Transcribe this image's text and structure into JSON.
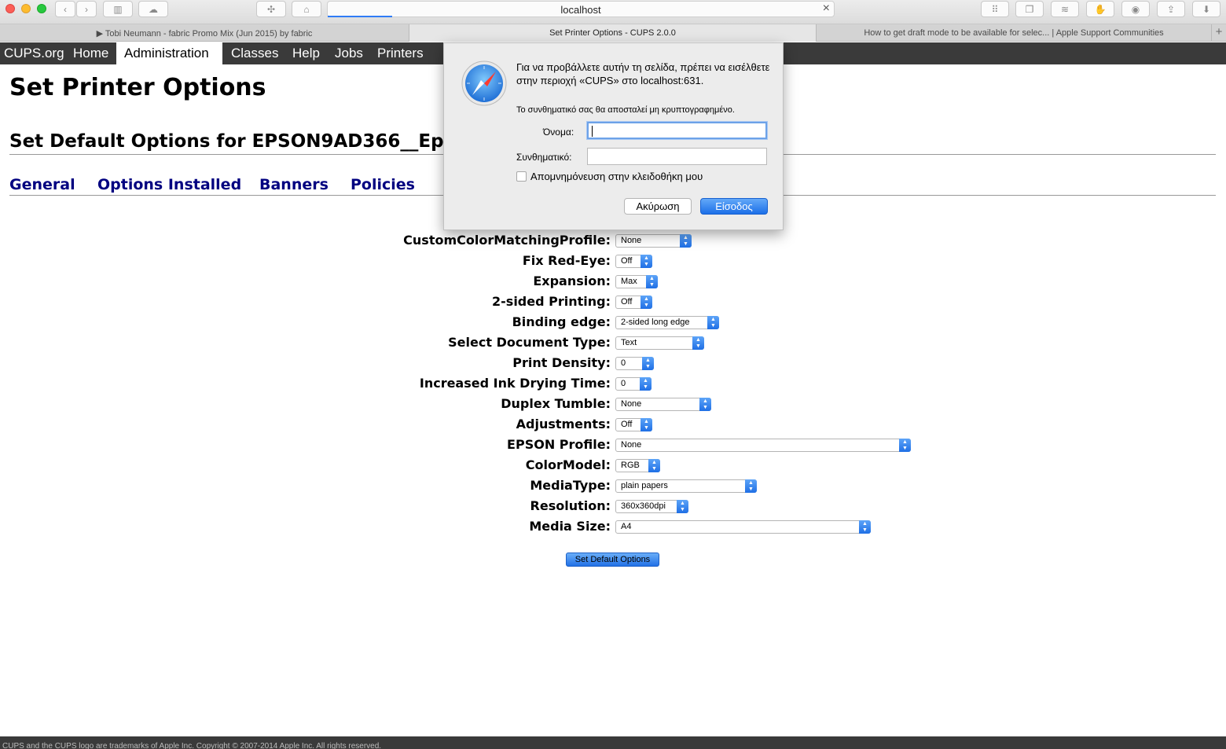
{
  "browser": {
    "address": "localhost",
    "tabs": [
      "▶ Tobi Neumann - fabric Promo Mix (Jun 2015) by fabric",
      "Set Printer Options - CUPS 2.0.0",
      "How to get draft mode to be available for selec... | Apple Support Communities"
    ],
    "new_tab": "+"
  },
  "nav": {
    "items": [
      "CUPS.org",
      "Home",
      "Administration",
      "Classes",
      "Help",
      "Jobs",
      "Printers"
    ],
    "active": "Administration"
  },
  "page": {
    "title": "Set Printer Options",
    "subtitle": "Set Default Options for EPSON9AD366__Epso",
    "sublinks": [
      "General",
      "Options Installed",
      "Banners",
      "Policies"
    ]
  },
  "options": [
    {
      "label": "CustomColorMatchingProfile:",
      "value": "None"
    },
    {
      "label": "Fix Red-Eye:",
      "value": "Off"
    },
    {
      "label": "Expansion:",
      "value": "Max"
    },
    {
      "label": "2-sided Printing:",
      "value": "Off"
    },
    {
      "label": "Binding edge:",
      "value": "2-sided long edge"
    },
    {
      "label": "Select Document Type:",
      "value": "Text"
    },
    {
      "label": "Print Density:",
      "value": "0"
    },
    {
      "label": "Increased Ink Drying Time:",
      "value": "0"
    },
    {
      "label": "Duplex Tumble:",
      "value": "None"
    },
    {
      "label": "Adjustments:",
      "value": "Off"
    },
    {
      "label": "EPSON Profile:",
      "value": "None"
    },
    {
      "label": "ColorModel:",
      "value": "RGB"
    },
    {
      "label": "MediaType:",
      "value": "plain papers"
    },
    {
      "label": "Resolution:",
      "value": "360x360dpi"
    },
    {
      "label": "Media Size:",
      "value": "A4"
    }
  ],
  "submit_label": "Set Default Options",
  "footer": "CUPS and the CUPS logo are trademarks of Apple Inc. Copyright © 2007-2014 Apple Inc. All rights reserved.",
  "auth_dialog": {
    "message": "Για να προβάλλετε αυτήν τη σελίδα, πρέπει να εισέλθετε στην περιοχή «CUPS» στο localhost:631.",
    "note": "Το συνθηματικό σας θα αποσταλεί μη κρυπτογραφημένο.",
    "name_label": "Όνομα:",
    "name_value": "",
    "password_label": "Συνθηματικό:",
    "password_value": "",
    "remember_label": "Απομνημόνευση στην κλειδοθήκη μου",
    "remember_checked": false,
    "cancel_label": "Ακύρωση",
    "login_label": "Είσοδος"
  }
}
